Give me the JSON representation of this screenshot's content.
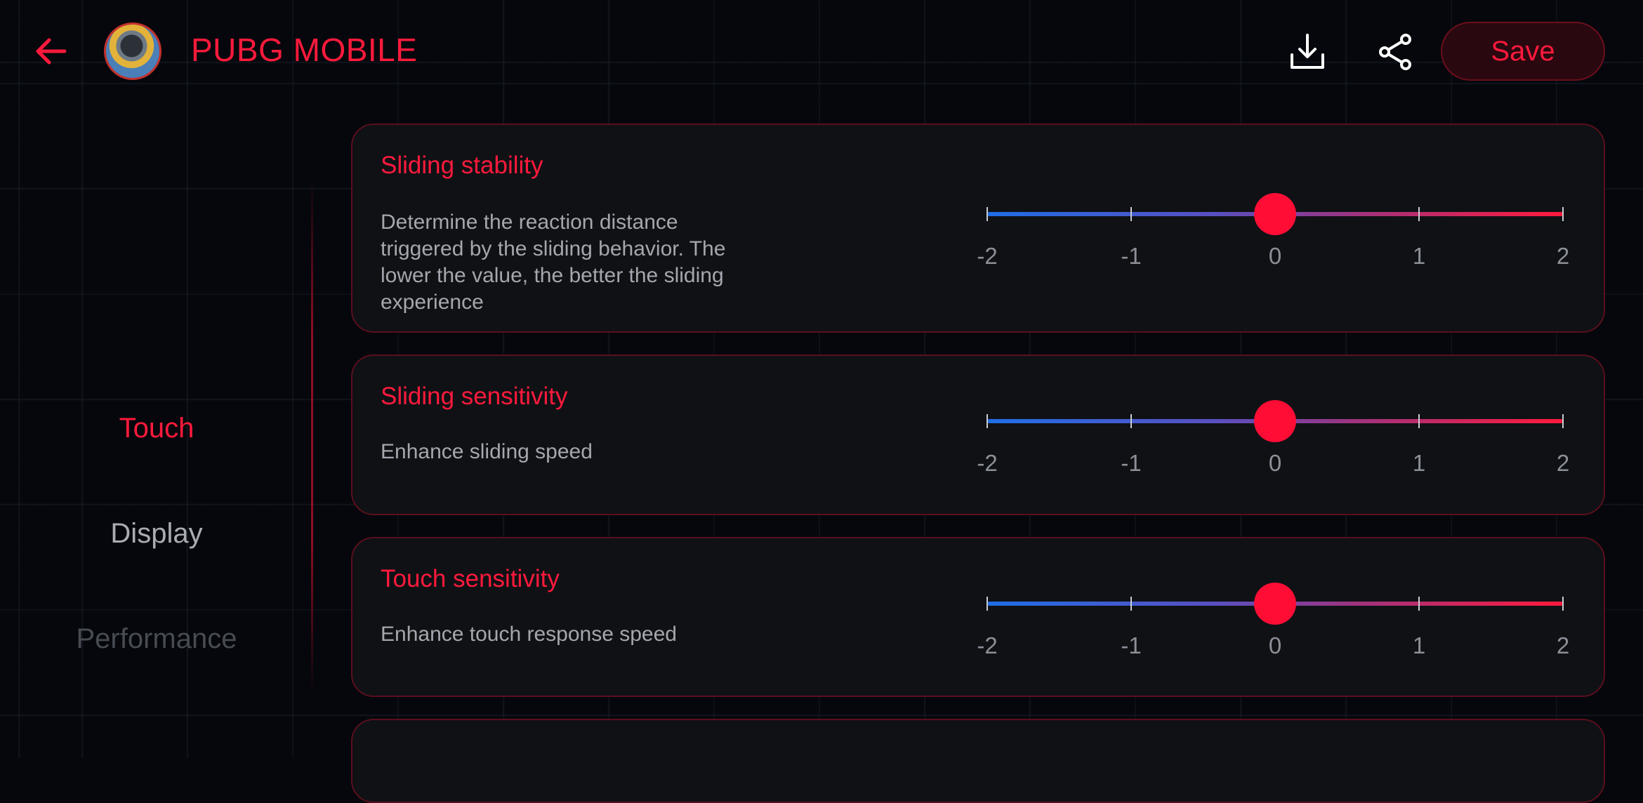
{
  "header": {
    "app_title": "PUBG MOBILE",
    "save_label": "Save",
    "icons": [
      "back-arrow-icon",
      "download-icon",
      "share-icon"
    ]
  },
  "tabs": [
    {
      "label": "Touch",
      "active": true
    },
    {
      "label": "Display",
      "active": false
    },
    {
      "label": "Performance",
      "active": false
    }
  ],
  "cards": [
    {
      "title": "Sliding stability",
      "description": "Determine the reaction distance triggered by the sliding behavior. The lower the value, the better the sliding experience",
      "value": 0,
      "min": -2,
      "max": 2,
      "tick_labels": [
        "-2",
        "-1",
        "0",
        "1",
        "2"
      ]
    },
    {
      "title": "Sliding sensitivity",
      "description": "Enhance sliding speed",
      "value": 0,
      "min": -2,
      "max": 2,
      "tick_labels": [
        "-2",
        "-1",
        "0",
        "1",
        "2"
      ]
    },
    {
      "title": "Touch sensitivity",
      "description": "Enhance touch response speed",
      "value": 0,
      "min": -2,
      "max": 2,
      "tick_labels": [
        "-2",
        "-1",
        "0",
        "1",
        "2"
      ]
    }
  ],
  "colors": {
    "accent": "#ff1a3c",
    "track_start": "#1f6ee6",
    "track_end": "#ff1a3c",
    "background": "#05070c"
  }
}
